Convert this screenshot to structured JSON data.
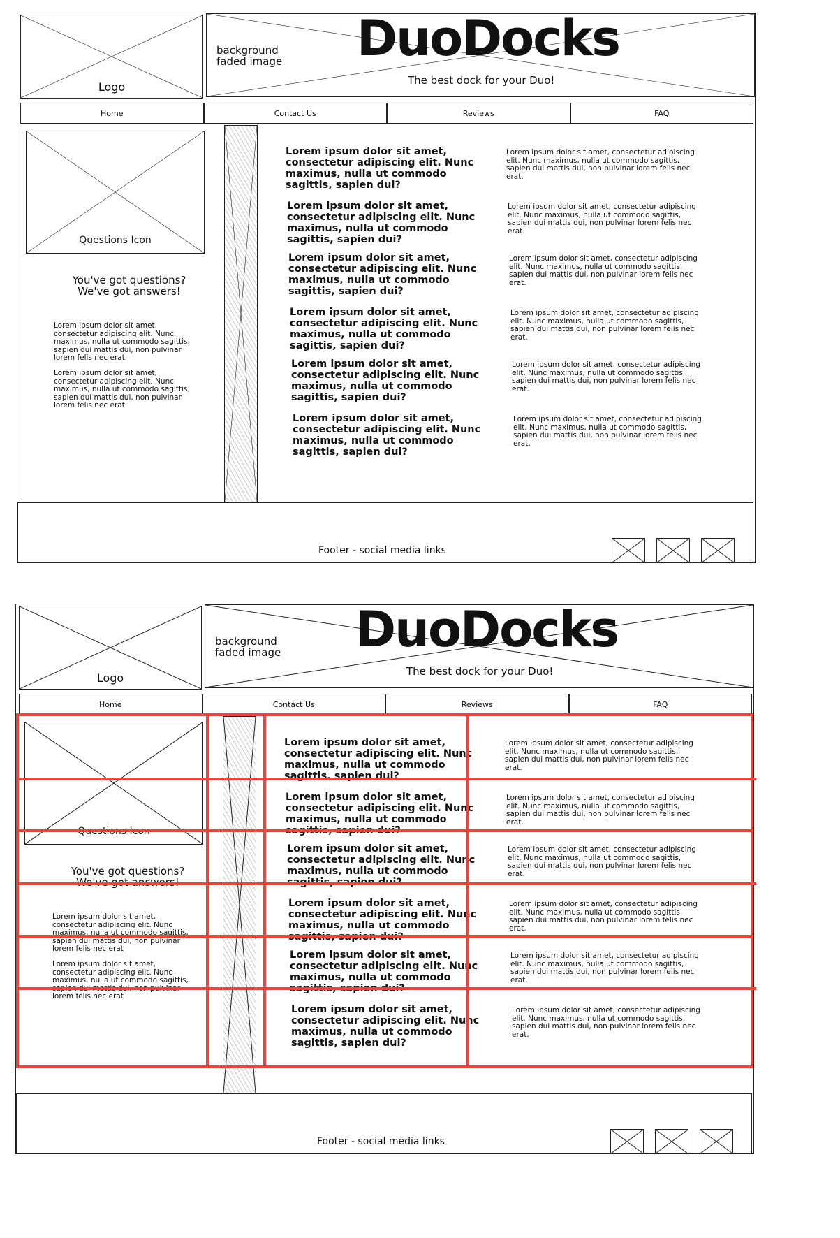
{
  "header": {
    "logo_label": "Logo",
    "background_label": "background faded image",
    "site_title": "DuoDocks",
    "tagline": "The best dock for your Duo!"
  },
  "nav": {
    "items": [
      "Home",
      "Contact Us",
      "Reviews",
      "FAQ"
    ]
  },
  "sidebar": {
    "questions_icon_label": "Questions Icon",
    "heading": "You've got questions? We've got answers!",
    "paragraphs": [
      "Lorem ipsum dolor sit amet, consectetur adipiscing elit. Nunc maximus, nulla ut commodo sagittis, sapien dui mattis dui, non pulvinar lorem felis nec erat",
      "Lorem ipsum dolor sit amet, consectetur adipiscing elit. Nunc maximus, nulla ut commodo sagittis, sapien dui mattis dui, non pulvinar lorem felis nec erat"
    ]
  },
  "faq": {
    "question_text": "Lorem ipsum dolor sit amet, consectetur adipiscing elit. Nunc maximus, nulla ut commodo sagittis, sapien dui?",
    "answer_text": "Lorem ipsum dolor sit amet, consectetur adipiscing elit. Nunc maximus, nulla ut commodo sagittis, sapien dui mattis dui, non pulvinar lorem felis nec erat.",
    "count": 6
  },
  "footer": {
    "label": "Footer - social media links",
    "social_icons": [
      "social-icon-1",
      "social-icon-2",
      "social-icon-3"
    ]
  },
  "colors": {
    "stroke": "#222222",
    "grid_overlay": "#e8453c",
    "hatch": "#cccccc"
  }
}
